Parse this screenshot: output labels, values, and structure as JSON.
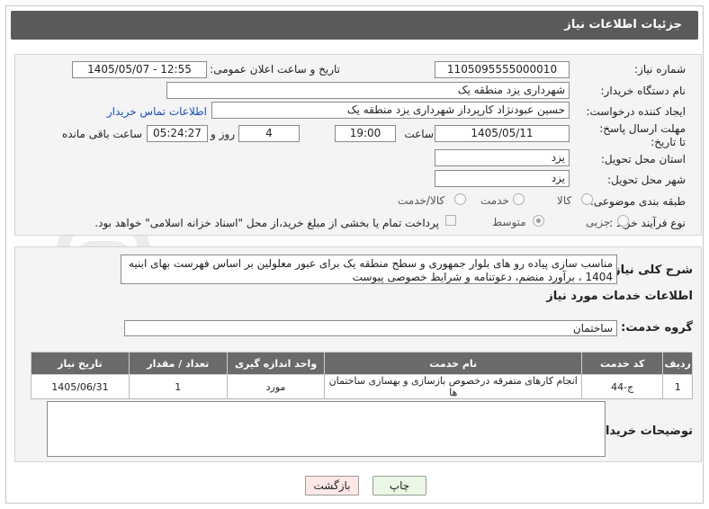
{
  "header": {
    "title": "جزئیات اطلاعات نیاز"
  },
  "fields": {
    "need_number_label": "شماره نیاز:",
    "need_number": "1105095555000010",
    "announce_label": "تاریخ و ساعت اعلان عمومی:",
    "announce_value": "1405/05/07 - 12:55",
    "buyer_org_label": "نام دستگاه خریدار:",
    "buyer_org": "شهرداری یزد منطقه یک",
    "creator_label": "ایجاد کننده درخواست:",
    "creator": "حسین عبودنژاد کارپرداز  شهرداری یزد منطقه یک",
    "contact_link": "اطلاعات تماس خریدار",
    "deadline_label": "مهلت ارسال پاسخ: تا تاریخ:",
    "deadline_date": "1405/05/11",
    "time_label": "ساعت",
    "deadline_time": "19:00",
    "days_value": "4",
    "days_label": "روز و",
    "remaining_time": "05:24:27",
    "remaining_label": "ساعت باقی مانده",
    "province_label": "استان محل تحویل:",
    "province": "یزد",
    "city_label": "شهر محل تحویل:",
    "city": "یزد",
    "category_label": "طبقه بندی موضوعی:",
    "category_options": [
      "کالا",
      "خدمت",
      "کالا/خدمت"
    ],
    "purchase_label": "نوع فرآیند خرید :",
    "purchase_options": [
      "جزیی",
      "متوسط"
    ],
    "payment_note": "پرداخت تمام یا بخشی از مبلغ خرید،از محل \"اسناد خزانه اسلامی\" خواهد بود."
  },
  "summary": {
    "label": "شرح کلی نیاز:",
    "text": "مناسب سازی پیاده رو های بلوار جمهوری و سطح منطقه یک برای عبور معلولین بر اساس فهرست بهای ابنیه 1404 ، برآورد منضم، دعوتنامه و شرایط خصوصی پیوست"
  },
  "services": {
    "section_title": "اطلاعات خدمات مورد نیاز",
    "group_label": "گروه خدمت:",
    "group_value": "ساختمان",
    "columns": [
      "ردیف",
      "کد خدمت",
      "نام خدمت",
      "واحد اندازه گیری",
      "تعداد / مقدار",
      "تاریخ نیاز"
    ],
    "rows": [
      [
        "1",
        "ج-44",
        "انجام کارهای متفرقه درخصوص بازسازی و بهسازی ساختمان ها",
        "مورد",
        "1",
        "1405/06/31"
      ]
    ]
  },
  "buyer_notes": {
    "label": "توضیحات خریدار:",
    "value": ""
  },
  "buttons": {
    "print": "چاپ",
    "back": "بازگشت"
  },
  "watermark": {
    "text": "AriaTender.neT"
  },
  "colors": {
    "header_bg": "#5a5a5a",
    "link": "#1a50b5",
    "table_header": "#6a6a6a",
    "back_button": "#fde7e7",
    "print_button": "#eaf7e4"
  }
}
